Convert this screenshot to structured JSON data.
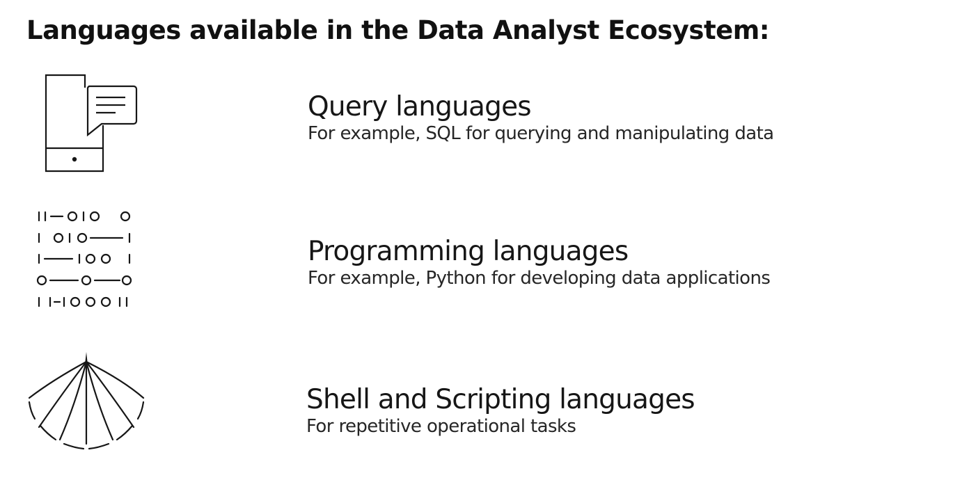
{
  "title": "Languages available in the Data Analyst Ecosystem:",
  "items": [
    {
      "heading": "Query languages",
      "description": "For example, SQL for querying and manipulating data",
      "icon": "mobile-chat-icon"
    },
    {
      "heading": "Programming languages",
      "description": "For example, Python for developing data applications",
      "icon": "binary-code-icon"
    },
    {
      "heading": "Shell and Scripting languages",
      "description": "For repetitive operational tasks",
      "icon": "fan-lines-icon"
    }
  ],
  "colors": {
    "text": "#161616",
    "icon_stroke": "#161616",
    "background": "#ffffff"
  }
}
